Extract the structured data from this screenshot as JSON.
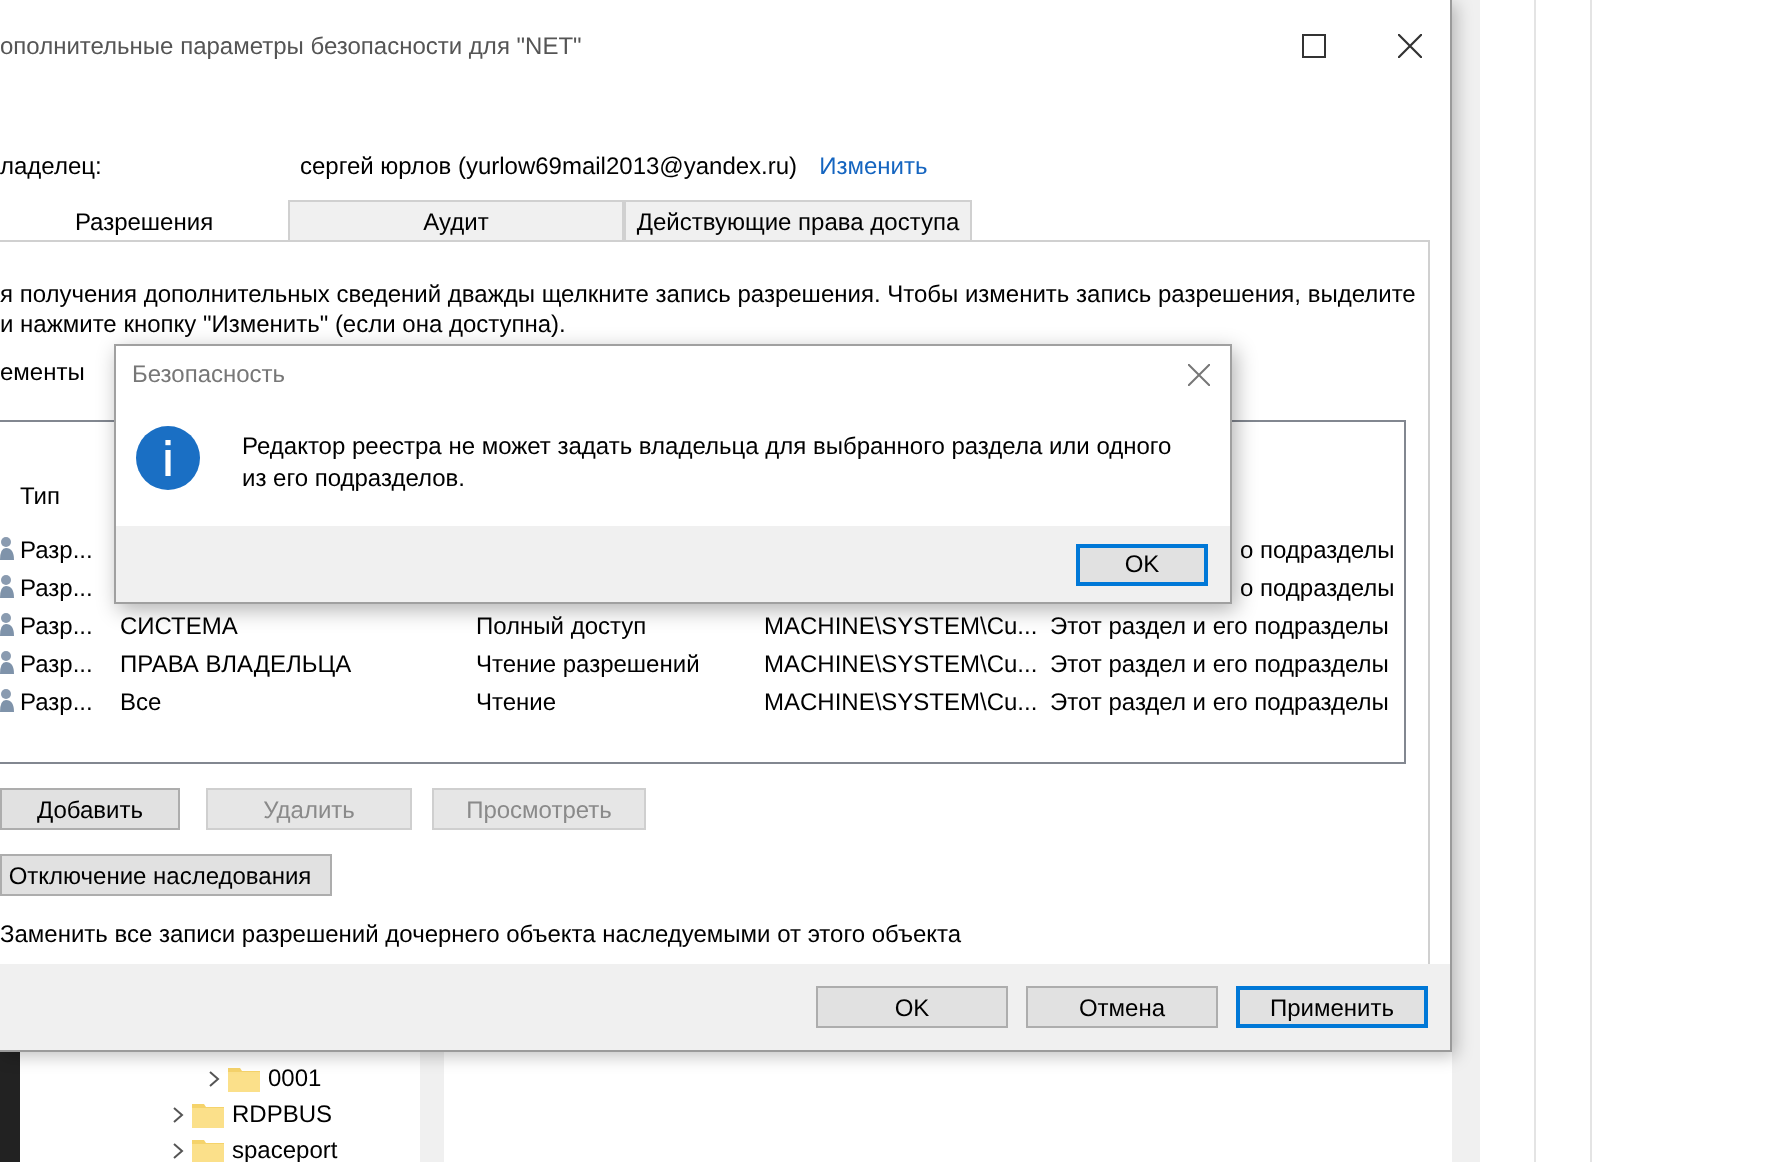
{
  "window": {
    "title": "ополнительные параметры безопасности  для \"NET\""
  },
  "owner": {
    "label": "ладелец:",
    "value": "сергей юрлов (yurlow69mail2013@yandex.ru)",
    "link": "Изменить"
  },
  "tabs": [
    {
      "label": "Разрешения",
      "selected": true
    },
    {
      "label": "Аудит",
      "selected": false
    },
    {
      "label": "Действующие права доступа",
      "selected": false
    }
  ],
  "info_lines": [
    "я получения дополнительных сведений дважды щелкните запись разрешения. Чтобы изменить запись разрешения, выделите",
    "и нажмите кнопку \"Изменить\" (если она доступна)."
  ],
  "list_label": "ементы",
  "table": {
    "columns": [
      "Тип"
    ],
    "rows": [
      {
        "type": "Разр...",
        "principal": "",
        "access": "",
        "inherited": "",
        "applies": "о подразделы"
      },
      {
        "type": "Разр...",
        "principal": "",
        "access": "",
        "inherited": "",
        "applies": "о подразделы"
      },
      {
        "type": "Разр...",
        "principal": "СИСТЕМА",
        "access": "Полный доступ",
        "inherited": "MACHINE\\SYSTEM\\Cu...",
        "applies": "Этот раздел и его подразделы"
      },
      {
        "type": "Разр...",
        "principal": "ПРАВА ВЛАДЕЛЬЦА",
        "access": "Чтение разрешений",
        "inherited": "MACHINE\\SYSTEM\\Cu...",
        "applies": "Этот раздел и его подразделы"
      },
      {
        "type": "Разр...",
        "principal": "Все",
        "access": "Чтение",
        "inherited": "MACHINE\\SYSTEM\\Cu...",
        "applies": "Этот раздел и его подразделы"
      }
    ]
  },
  "entry_buttons": [
    {
      "label": "Добавить",
      "disabled": false
    },
    {
      "label": "Удалить",
      "disabled": true
    },
    {
      "label": "Просмотреть",
      "disabled": true
    }
  ],
  "inheritance_button": "Отключение наследования",
  "replace_option": "Заменить все записи разрешений дочернего объекта наследуемыми от этого объекта",
  "footer_buttons": [
    {
      "label": "OK",
      "default": false
    },
    {
      "label": "Отмена",
      "default": false
    },
    {
      "label": "Применить",
      "default": true
    }
  ],
  "tree": [
    {
      "label": "0001",
      "kind": "child"
    },
    {
      "label": "RDPBUS",
      "kind": "parent"
    },
    {
      "label": "spaceport",
      "kind": "parent"
    }
  ],
  "dialog": {
    "title": "Безопасность",
    "message": "Редактор реестра не может задать владельца для выбранного раздела или одного из его подразделов.",
    "button": "OK"
  }
}
